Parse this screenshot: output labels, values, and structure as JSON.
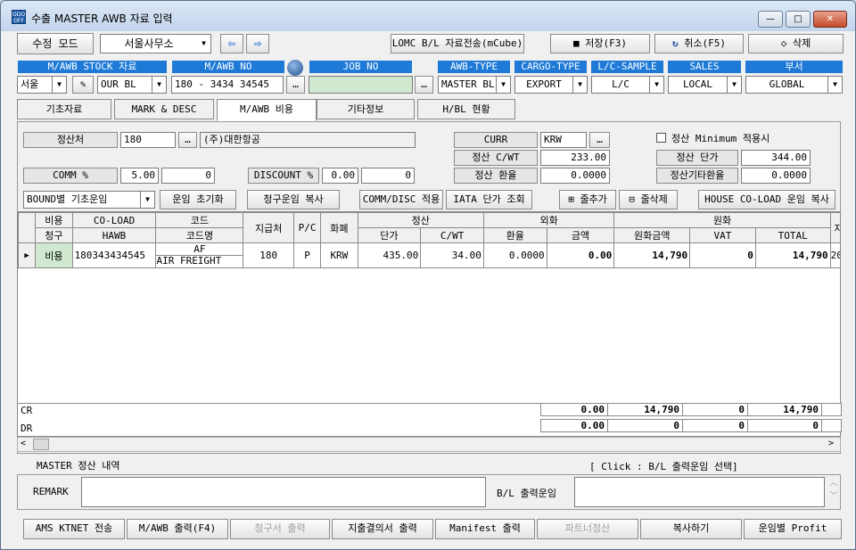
{
  "window": {
    "title": "수출 MASTER AWB 자료 입력",
    "icon_text": "ODO OFF",
    "min": "—",
    "max": "□",
    "close": "✕"
  },
  "toolbar": {
    "mode": "수정 모드",
    "office": "서울사무소",
    "send": "LOMC B/L 자료전송(mCube)",
    "save": "저장(F3)",
    "cancel": "취소(F5)",
    "delete": "삭제"
  },
  "headers": {
    "stock": "M/AWB STOCK 자료",
    "mawb": "M/AWB NO",
    "job": "JOB NO",
    "awbtype": "AWB-TYPE",
    "cargotype": "CARGO-TYPE",
    "lcsample": "L/C-SAMPLE",
    "sales": "SALES",
    "dept": "부서"
  },
  "values": {
    "stock_city": "서울",
    "stock_bl": "OUR BL",
    "mawb_no": "180 - 3434 34545",
    "job_no": "",
    "awbtype": "MASTER BL",
    "cargotype": "EXPORT",
    "lcsample": "L/C",
    "sales": "LOCAL",
    "dept": "GLOBAL"
  },
  "tabs": [
    "기초자료",
    "MARK & DESC",
    "M/AWB 비용",
    "기타정보",
    "H/BL 현황"
  ],
  "settle": {
    "label_settle": "정산처",
    "settle_code": "180",
    "settle_name": "(주)대한항공",
    "label_curr": "CURR",
    "curr": "KRW",
    "minimum": "정산 Minimum 적용시",
    "label_cwt": "정산 C/WT",
    "cwt": "233.00",
    "label_unit": "정산 단가",
    "unit": "344.00",
    "label_rate": "정산 환율",
    "rate": "0.0000",
    "label_etc_rate": "정산기타환율",
    "etc_rate": "0.0000",
    "label_comm": "COMM %",
    "comm_pct": "5.00",
    "comm_amt": "0",
    "label_disc": "DISCOUNT %",
    "disc_pct": "0.00",
    "disc_amt": "0"
  },
  "actions": {
    "bound": "BOUND별 기초운임",
    "reset": "운임 초기화",
    "copy_claim": "청구운임 복사",
    "comm_disc": "COMM/DISC 적용",
    "iata": "IATA 단가 조회",
    "add_row": "줄추가",
    "del_row": "줄삭제",
    "house": "HOUSE CO-LOAD 운임 복사"
  },
  "grid": {
    "h": {
      "cost": "비용",
      "claim": "청구",
      "coload": "CO-LOAD",
      "hawb": "HAWB",
      "code": "코드",
      "codename": "코드명",
      "payer": "지급처",
      "pc": "P/C",
      "currency": "화폐",
      "settle": "정산",
      "unitprice": "단가",
      "cwt": "C/WT",
      "foreign": "외화",
      "exrate": "환율",
      "amount": "금액",
      "won": "원화",
      "wonamt": "원화금액",
      "vat": "VAT",
      "total": "TOTAL",
      "paydate": "지급"
    },
    "row": {
      "marker": "▶",
      "cost": "비용",
      "coload": "180343434545",
      "code": "AF",
      "codename": "AIR FREIGHT",
      "payer": "180",
      "pc": "P",
      "currency": "KRW",
      "unitprice": "435.00",
      "cwt": "34.00",
      "exrate": "0.0000",
      "amount": "0.00",
      "wonamt": "14,790",
      "vat": "0",
      "total": "14,790",
      "paydate": "20"
    }
  },
  "summary": {
    "cr": "CR",
    "cr_amount": "0.00",
    "cr_wonamt": "14,790",
    "cr_vat": "0",
    "cr_total": "14,790",
    "dr": "DR",
    "dr_amount": "0.00",
    "dr_wonamt": "0",
    "dr_vat": "0",
    "dr_total": "0"
  },
  "master": {
    "label": "MASTER 정산 내역",
    "hint": "[ Click : B/L 출력운임 선택]",
    "remark_label": "REMARK",
    "remark": "",
    "bl_label": "B/L 출력운임",
    "bl_value": ""
  },
  "bottom": [
    "AMS KTNET 전송",
    "M/AWB 출력(F4)",
    "청구서 출력",
    "지출결의서 출력",
    "Manifest 출력",
    "파트너정산",
    "복사하기",
    "운임별 Profit"
  ]
}
